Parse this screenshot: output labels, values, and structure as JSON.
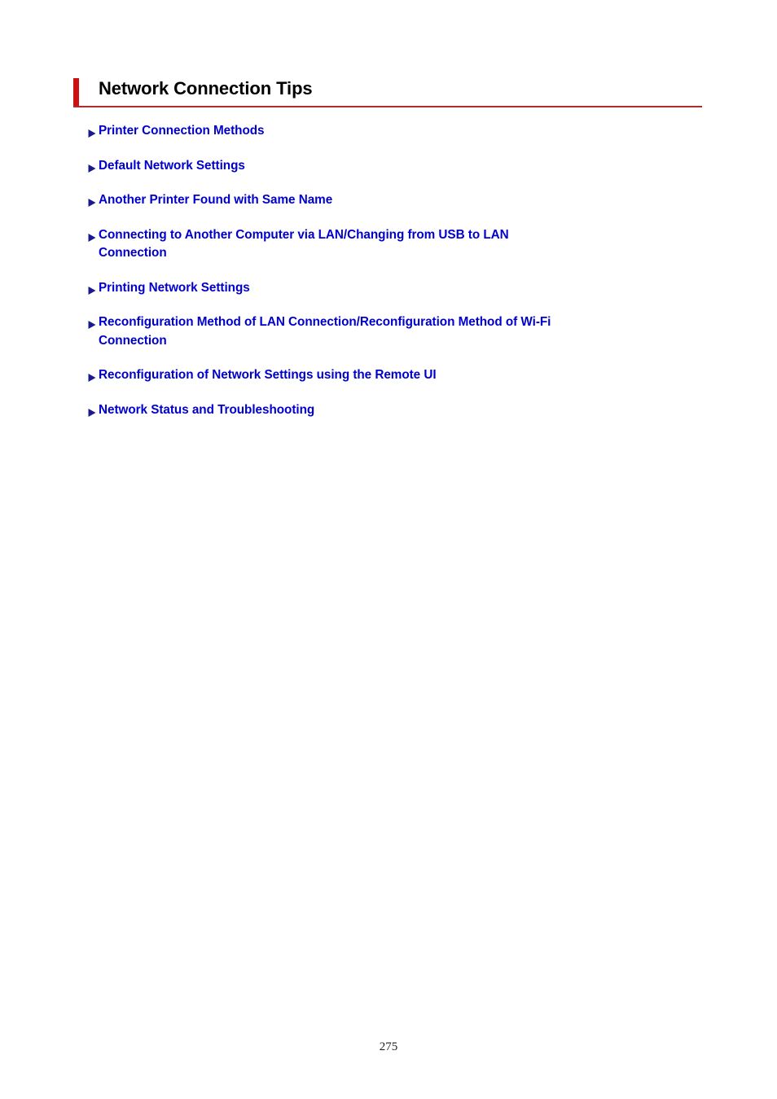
{
  "document": {
    "title": "Network Connection Tips",
    "page_number": "275",
    "accent_bar_color": "#cc1111",
    "rule_color": "#b02b2b",
    "link_color": "#0000cc",
    "arrow_icon": "right-triangle-arrow"
  },
  "links": [
    {
      "line1": "Printer Connection Methods",
      "line2": ""
    },
    {
      "line1": "Default Network Settings",
      "line2": ""
    },
    {
      "line1": "Another Printer Found with Same Name",
      "line2": ""
    },
    {
      "line1": "Connecting to Another Computer via LAN/Changing from USB to LAN",
      "line2": "Connection"
    },
    {
      "line1": "Printing Network Settings",
      "line2": ""
    },
    {
      "line1": "Reconfiguration Method of LAN Connection/Reconfiguration Method of Wi-Fi",
      "line2": "Connection"
    },
    {
      "line1": "Reconfiguration of Network Settings using the Remote UI",
      "line2": ""
    },
    {
      "line1": "Network Status and Troubleshooting",
      "line2": ""
    }
  ]
}
